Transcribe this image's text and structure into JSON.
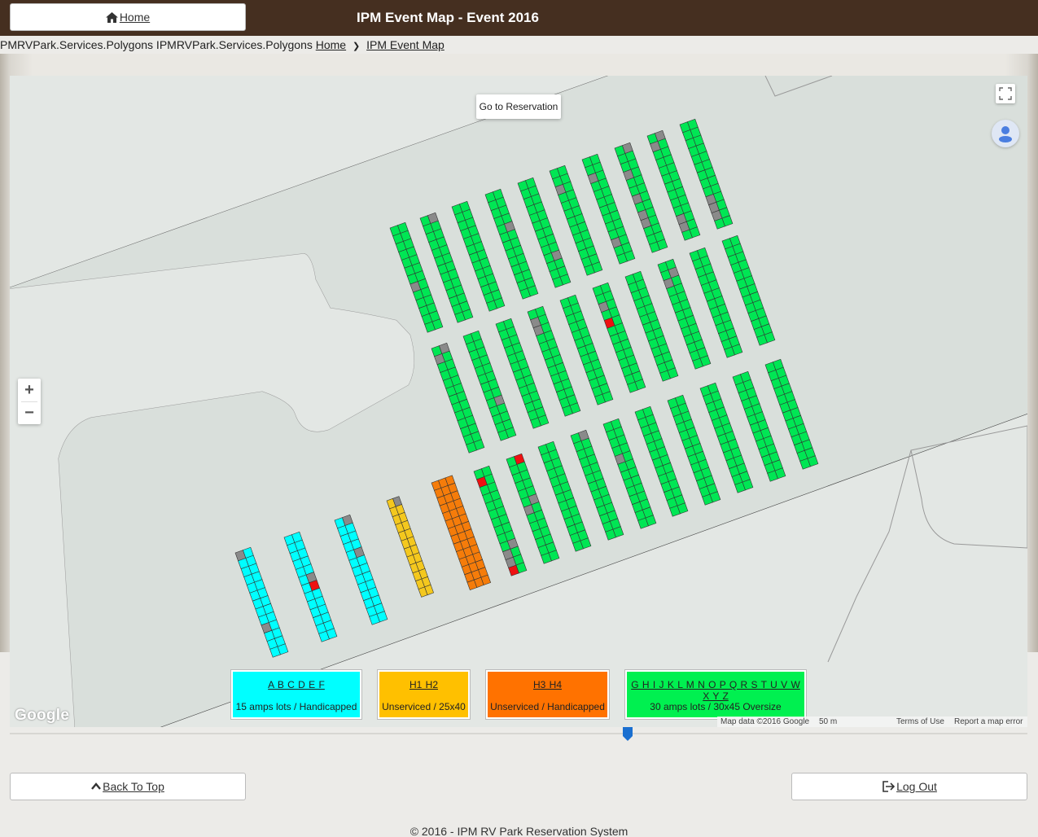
{
  "header": {
    "home_label": "Home",
    "title": "IPM Event Map - Event 2016"
  },
  "breadcrumb": {
    "prefix": "PMRVPark.Services.Polygons IPMRVPark.Services.Polygons",
    "home": "Home",
    "current": "IPM Event Map"
  },
  "map": {
    "goto_label": "Go to Reservation",
    "zoom_in": "+",
    "zoom_out": "−",
    "logo": "Google",
    "attribution": {
      "data": "Map data ©2016 Google",
      "scale": "50 m",
      "terms": "Terms of Use",
      "report": "Report a map error"
    },
    "colors": {
      "cyan": "#00ffff",
      "yellow": "#f4c81e",
      "orange": "#f57c0a",
      "green": "#00e654",
      "occupied": "#8a8a8a",
      "selected": "#ee1111"
    }
  },
  "legend": [
    {
      "letters": "A B C D E F",
      "desc": "15 amps lots / Handicapped",
      "color": "#00ffff"
    },
    {
      "letters": "H1 H2",
      "desc": "Unserviced / 25x40",
      "color": "#ffc000"
    },
    {
      "letters": "H3 H4",
      "desc": "Unserviced / Handicapped",
      "color": "#ff7200"
    },
    {
      "letters": "G H I J K L M N O P Q R S T U V W X Y Z",
      "desc": "30 amps lots / 30x45 Oversize",
      "color": "#00f050"
    }
  ],
  "footer": {
    "back_to_top": "Back To Top",
    "logout": "Log Out",
    "copyright": "© 2016 - IPM RV Park Reservation System"
  }
}
